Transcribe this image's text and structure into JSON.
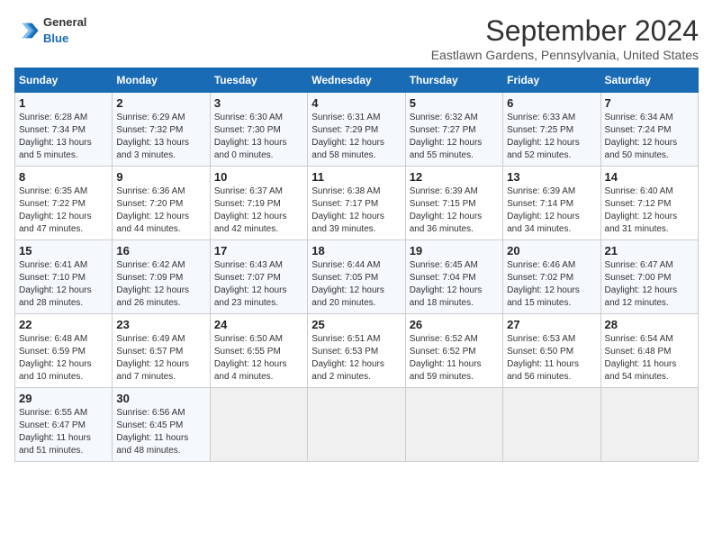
{
  "header": {
    "logo_general": "General",
    "logo_blue": "Blue",
    "month_title": "September 2024",
    "location": "Eastlawn Gardens, Pennsylvania, United States"
  },
  "calendar": {
    "days_of_week": [
      "Sunday",
      "Monday",
      "Tuesday",
      "Wednesday",
      "Thursday",
      "Friday",
      "Saturday"
    ],
    "weeks": [
      [
        {
          "day": "1",
          "info": "Sunrise: 6:28 AM\nSunset: 7:34 PM\nDaylight: 13 hours\nand 5 minutes."
        },
        {
          "day": "2",
          "info": "Sunrise: 6:29 AM\nSunset: 7:32 PM\nDaylight: 13 hours\nand 3 minutes."
        },
        {
          "day": "3",
          "info": "Sunrise: 6:30 AM\nSunset: 7:30 PM\nDaylight: 13 hours\nand 0 minutes."
        },
        {
          "day": "4",
          "info": "Sunrise: 6:31 AM\nSunset: 7:29 PM\nDaylight: 12 hours\nand 58 minutes."
        },
        {
          "day": "5",
          "info": "Sunrise: 6:32 AM\nSunset: 7:27 PM\nDaylight: 12 hours\nand 55 minutes."
        },
        {
          "day": "6",
          "info": "Sunrise: 6:33 AM\nSunset: 7:25 PM\nDaylight: 12 hours\nand 52 minutes."
        },
        {
          "day": "7",
          "info": "Sunrise: 6:34 AM\nSunset: 7:24 PM\nDaylight: 12 hours\nand 50 minutes."
        }
      ],
      [
        {
          "day": "8",
          "info": "Sunrise: 6:35 AM\nSunset: 7:22 PM\nDaylight: 12 hours\nand 47 minutes."
        },
        {
          "day": "9",
          "info": "Sunrise: 6:36 AM\nSunset: 7:20 PM\nDaylight: 12 hours\nand 44 minutes."
        },
        {
          "day": "10",
          "info": "Sunrise: 6:37 AM\nSunset: 7:19 PM\nDaylight: 12 hours\nand 42 minutes."
        },
        {
          "day": "11",
          "info": "Sunrise: 6:38 AM\nSunset: 7:17 PM\nDaylight: 12 hours\nand 39 minutes."
        },
        {
          "day": "12",
          "info": "Sunrise: 6:39 AM\nSunset: 7:15 PM\nDaylight: 12 hours\nand 36 minutes."
        },
        {
          "day": "13",
          "info": "Sunrise: 6:39 AM\nSunset: 7:14 PM\nDaylight: 12 hours\nand 34 minutes."
        },
        {
          "day": "14",
          "info": "Sunrise: 6:40 AM\nSunset: 7:12 PM\nDaylight: 12 hours\nand 31 minutes."
        }
      ],
      [
        {
          "day": "15",
          "info": "Sunrise: 6:41 AM\nSunset: 7:10 PM\nDaylight: 12 hours\nand 28 minutes."
        },
        {
          "day": "16",
          "info": "Sunrise: 6:42 AM\nSunset: 7:09 PM\nDaylight: 12 hours\nand 26 minutes."
        },
        {
          "day": "17",
          "info": "Sunrise: 6:43 AM\nSunset: 7:07 PM\nDaylight: 12 hours\nand 23 minutes."
        },
        {
          "day": "18",
          "info": "Sunrise: 6:44 AM\nSunset: 7:05 PM\nDaylight: 12 hours\nand 20 minutes."
        },
        {
          "day": "19",
          "info": "Sunrise: 6:45 AM\nSunset: 7:04 PM\nDaylight: 12 hours\nand 18 minutes."
        },
        {
          "day": "20",
          "info": "Sunrise: 6:46 AM\nSunset: 7:02 PM\nDaylight: 12 hours\nand 15 minutes."
        },
        {
          "day": "21",
          "info": "Sunrise: 6:47 AM\nSunset: 7:00 PM\nDaylight: 12 hours\nand 12 minutes."
        }
      ],
      [
        {
          "day": "22",
          "info": "Sunrise: 6:48 AM\nSunset: 6:59 PM\nDaylight: 12 hours\nand 10 minutes."
        },
        {
          "day": "23",
          "info": "Sunrise: 6:49 AM\nSunset: 6:57 PM\nDaylight: 12 hours\nand 7 minutes."
        },
        {
          "day": "24",
          "info": "Sunrise: 6:50 AM\nSunset: 6:55 PM\nDaylight: 12 hours\nand 4 minutes."
        },
        {
          "day": "25",
          "info": "Sunrise: 6:51 AM\nSunset: 6:53 PM\nDaylight: 12 hours\nand 2 minutes."
        },
        {
          "day": "26",
          "info": "Sunrise: 6:52 AM\nSunset: 6:52 PM\nDaylight: 11 hours\nand 59 minutes."
        },
        {
          "day": "27",
          "info": "Sunrise: 6:53 AM\nSunset: 6:50 PM\nDaylight: 11 hours\nand 56 minutes."
        },
        {
          "day": "28",
          "info": "Sunrise: 6:54 AM\nSunset: 6:48 PM\nDaylight: 11 hours\nand 54 minutes."
        }
      ],
      [
        {
          "day": "29",
          "info": "Sunrise: 6:55 AM\nSunset: 6:47 PM\nDaylight: 11 hours\nand 51 minutes."
        },
        {
          "day": "30",
          "info": "Sunrise: 6:56 AM\nSunset: 6:45 PM\nDaylight: 11 hours\nand 48 minutes."
        },
        {
          "day": "",
          "info": ""
        },
        {
          "day": "",
          "info": ""
        },
        {
          "day": "",
          "info": ""
        },
        {
          "day": "",
          "info": ""
        },
        {
          "day": "",
          "info": ""
        }
      ]
    ]
  }
}
